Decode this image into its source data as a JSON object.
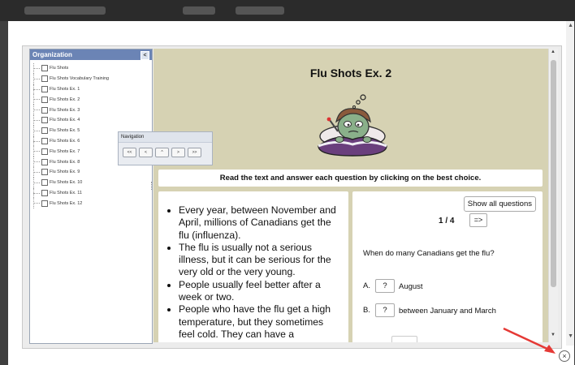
{
  "organization": {
    "title": "Organization",
    "collapse_icon": "chevron-left-icon",
    "items": [
      "Flu Shots",
      "Flu Shots Vocabulary Training",
      "Flu Shots Ex. 1",
      "Flu Shots Ex. 2",
      "Flu Shots Ex. 3",
      "Flu Shots Ex. 4",
      "Flu Shots Ex. 5",
      "Flu Shots Ex. 6",
      "Flu Shots Ex. 7",
      "Flu Shots Ex. 8",
      "Flu Shots Ex. 9",
      "Flu Shots Ex. 10",
      "Flu Shots Ex. 11",
      "Flu Shots Ex. 12"
    ]
  },
  "navigation": {
    "title": "Navigation",
    "buttons": [
      "<<",
      "<",
      "^",
      ">",
      ">>"
    ]
  },
  "lesson": {
    "title": "Flu Shots Ex. 2",
    "instructions": "Read the text and answer each question by clicking on the best choice.",
    "bullets": [
      "Every year, between November and April, millions of Canadians get the flu (influenza).",
      "The flu is usually not a serious illness, but it can be serious for the very old or the very young.",
      "People usually feel better after a week or two.",
      "People who have the flu get a high temperature, but they sometimes feel cold. They can have a"
    ]
  },
  "quiz": {
    "show_all_label": "Show all questions",
    "counter": "1 / 4",
    "next_label": "=>",
    "question": "When do many Canadians get the flu?",
    "options": [
      {
        "letter": "A.",
        "button": "?",
        "text": "August"
      },
      {
        "letter": "B.",
        "button": "?",
        "text": "between January and March"
      }
    ]
  },
  "window": {
    "close_icon": "close-icon",
    "close_glyph": "×",
    "scroll_up": "▲",
    "scroll_down": "▼"
  },
  "colors": {
    "content_bg": "#d6d2b3",
    "org_header": "#6b84b5",
    "annotation_arrow": "#e53935"
  }
}
